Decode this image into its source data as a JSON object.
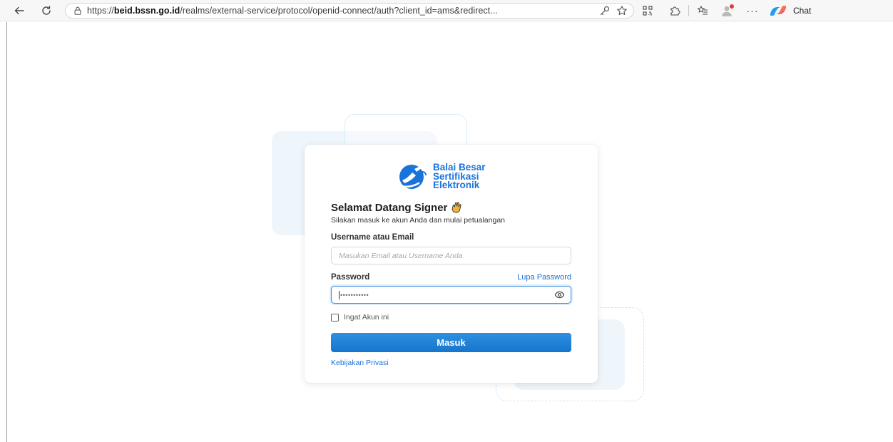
{
  "browser": {
    "url_prefix": "https://",
    "url_domain": "beid.bssn.go.id",
    "url_path": "/realms/external-service/protocol/openid-connect/auth?client_id=ams&redirect...",
    "chat_label": "Chat",
    "icons": [
      "back-icon",
      "refresh-icon",
      "lock-icon",
      "key-icon",
      "star-icon",
      "qr-icon",
      "extensions-icon",
      "favorites-icon",
      "profile-icon",
      "more-icon",
      "copilot-icon"
    ]
  },
  "brand": {
    "line1": "Balai Besar",
    "line2": "Sertifikasi",
    "line3": "Elektronik",
    "color": "#1a73d9"
  },
  "login": {
    "title": "Selamat Datang Signer",
    "subtitle": "Silakan masuk ke akun Anda dan mulai petualangan",
    "username_label": "Username atau Email",
    "username_placeholder": "Masukan Email atau Username Anda",
    "username_value": "",
    "password_label": "Password",
    "forgot_label": "Lupa Password",
    "password_value": "•••••••••••",
    "remember_label": "Ingat Akun ini",
    "remember_checked": false,
    "submit_label": "Masuk",
    "privacy_label": "Kebijakan Privasi",
    "button_color": "#1a7fd4"
  }
}
